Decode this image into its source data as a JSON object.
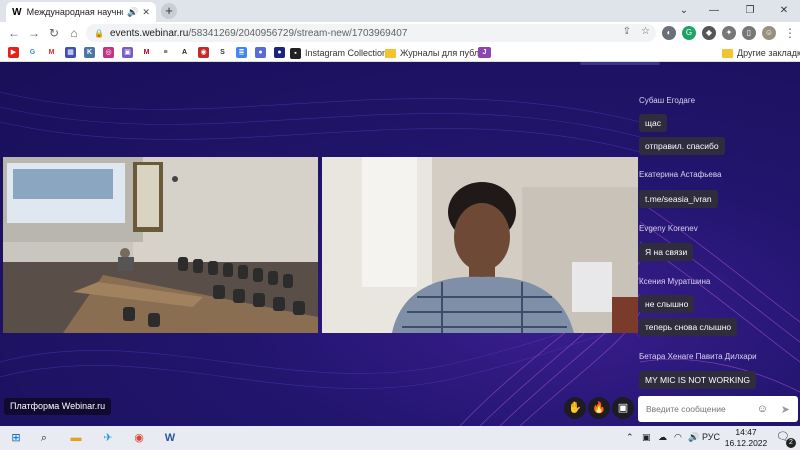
{
  "browser": {
    "tab_title": "Международная научно-пр",
    "tab_favicon": "W",
    "url_host": "events.webinar.ru",
    "url_path": "/58341269/2040956729/stream-new/1703969407",
    "bookmarks": {
      "instagram_collection": "Instagram Collection",
      "journals": "Журналы для публ...",
      "other": "Другие закладки"
    }
  },
  "webinar": {
    "platform_label": "Платформа Webinar.ru",
    "chat": {
      "messages": [
        {
          "author": "Субаш Егодаге",
          "bubbles": [
            "щас",
            "отправил. спасибо"
          ]
        },
        {
          "author": "Екатерина Астафьева",
          "bubbles": [
            "t.me/seasia_ivran"
          ]
        },
        {
          "author": "Evgeny Korenev",
          "bubbles": [
            "Я на связи"
          ]
        },
        {
          "author": "Ксения Муратшина",
          "bubbles": [
            "не слышно",
            "теперь снова слышно"
          ]
        },
        {
          "author": "Бетара Хенаге Павита Дилхари",
          "bubbles": [
            "MY MIC IS NOT WORKING"
          ]
        }
      ],
      "input_placeholder": "Введите сообщение"
    }
  },
  "taskbar": {
    "language": "РУС",
    "time": "14:47",
    "date": "16.12.2022",
    "notification_count": "2"
  },
  "colors": {
    "stage_bg": "#1d1360",
    "bubble_bg": "#2f2c3d",
    "accent_wave": "#b45ad6"
  }
}
